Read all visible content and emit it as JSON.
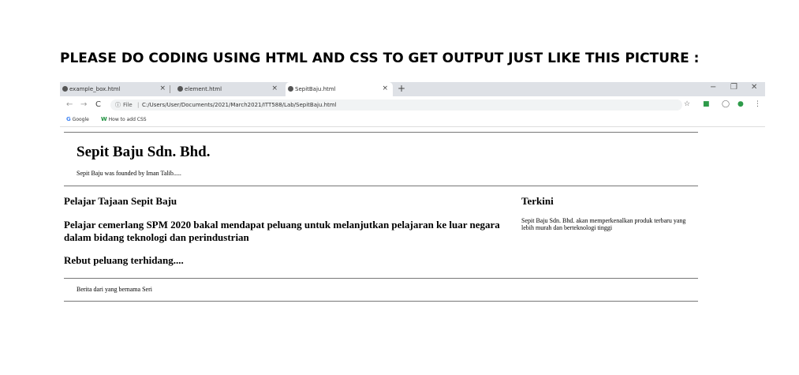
{
  "instruction": "PLEASE DO CODING USING HTML AND CSS TO GET OUTPUT JUST LIKE THIS PICTURE :",
  "browser": {
    "tabs": [
      {
        "title": "example_box.html"
      },
      {
        "title": "element.html"
      },
      {
        "title": "SepitBaju.html"
      }
    ],
    "new_tab": "+",
    "window_controls": {
      "minimize": "−",
      "restore": "❐",
      "close": "✕"
    },
    "nav": {
      "back": "←",
      "forward": "→",
      "reload": "C"
    },
    "address": {
      "info": "ⓘ",
      "scheme": "File",
      "separator": "|",
      "url": "C:/Users/User/Documents/2021/March2021/ITT588/Lab/SepitBaju.html"
    },
    "bookmarks": [
      {
        "icon": "G",
        "label": "Google"
      },
      {
        "icon": "W",
        "label": "How to add CSS"
      }
    ]
  },
  "page": {
    "site_title": "Sepit Baju Sdn. Bhd.",
    "site_subtitle": "Sepit Baju was founded by Iman Talib.....",
    "main_heading": "Pelajar Tajaan Sepit Baju",
    "news_heading": "Pelajar cemerlang SPM 2020 bakal mendapat peluang untuk melanjutkan pelajaran ke luar negara dalam bidang teknologi dan perindustrian",
    "rebut_heading": "Rebut peluang terhidang....",
    "sidebar_heading": "Terkini",
    "sidebar_text": "Sepit Baju Sdn. Bhd. akan memperkenalkan produk terbaru yang lebih murah dan berteknologi tinggi",
    "footer_text": "Berita dari yang bernama Seri"
  },
  "colors": {
    "tabstrip": "#dee1e6",
    "rule": "#777777"
  }
}
